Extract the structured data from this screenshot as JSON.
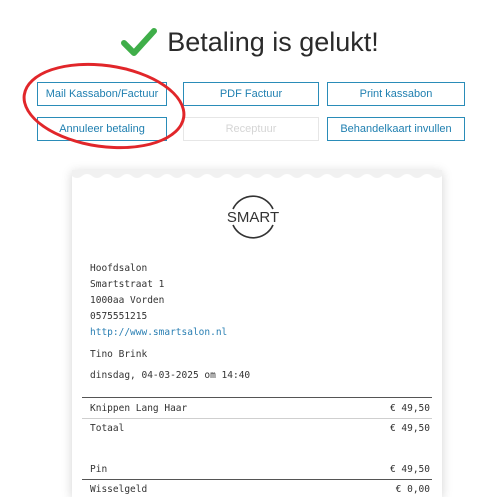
{
  "header": {
    "title": "Betaling is gelukt!"
  },
  "buttons": {
    "mail": "Mail Kassabon/Factuur",
    "pdf": "PDF Factuur",
    "print": "Print kassabon",
    "cancel": "Annuleer betaling",
    "prescription": "Receptuur",
    "treatment_card": "Behandelkaart invullen"
  },
  "receipt": {
    "logo_text": "SMART",
    "salon": "Hoofdsalon",
    "street": "Smartstraat 1",
    "city": "1000aa Vorden",
    "phone": "0575551215",
    "website": "http://www.smartsalon.nl",
    "employee": "Tino Brink",
    "datetime": "dinsdag, 04-03-2025 om 14:40",
    "items": [
      {
        "name": "Knippen Lang Haar",
        "amount": "€ 49,50"
      }
    ],
    "total_label": "Totaal",
    "total_amount": "€ 49,50",
    "payment_label": "Pin",
    "payment_amount": "€ 49,50",
    "change_label": "Wisselgeld",
    "change_amount": "€ 0,00"
  },
  "colors": {
    "accent": "#2a8cb8",
    "success": "#3fae49",
    "annotation": "#e1262a"
  }
}
